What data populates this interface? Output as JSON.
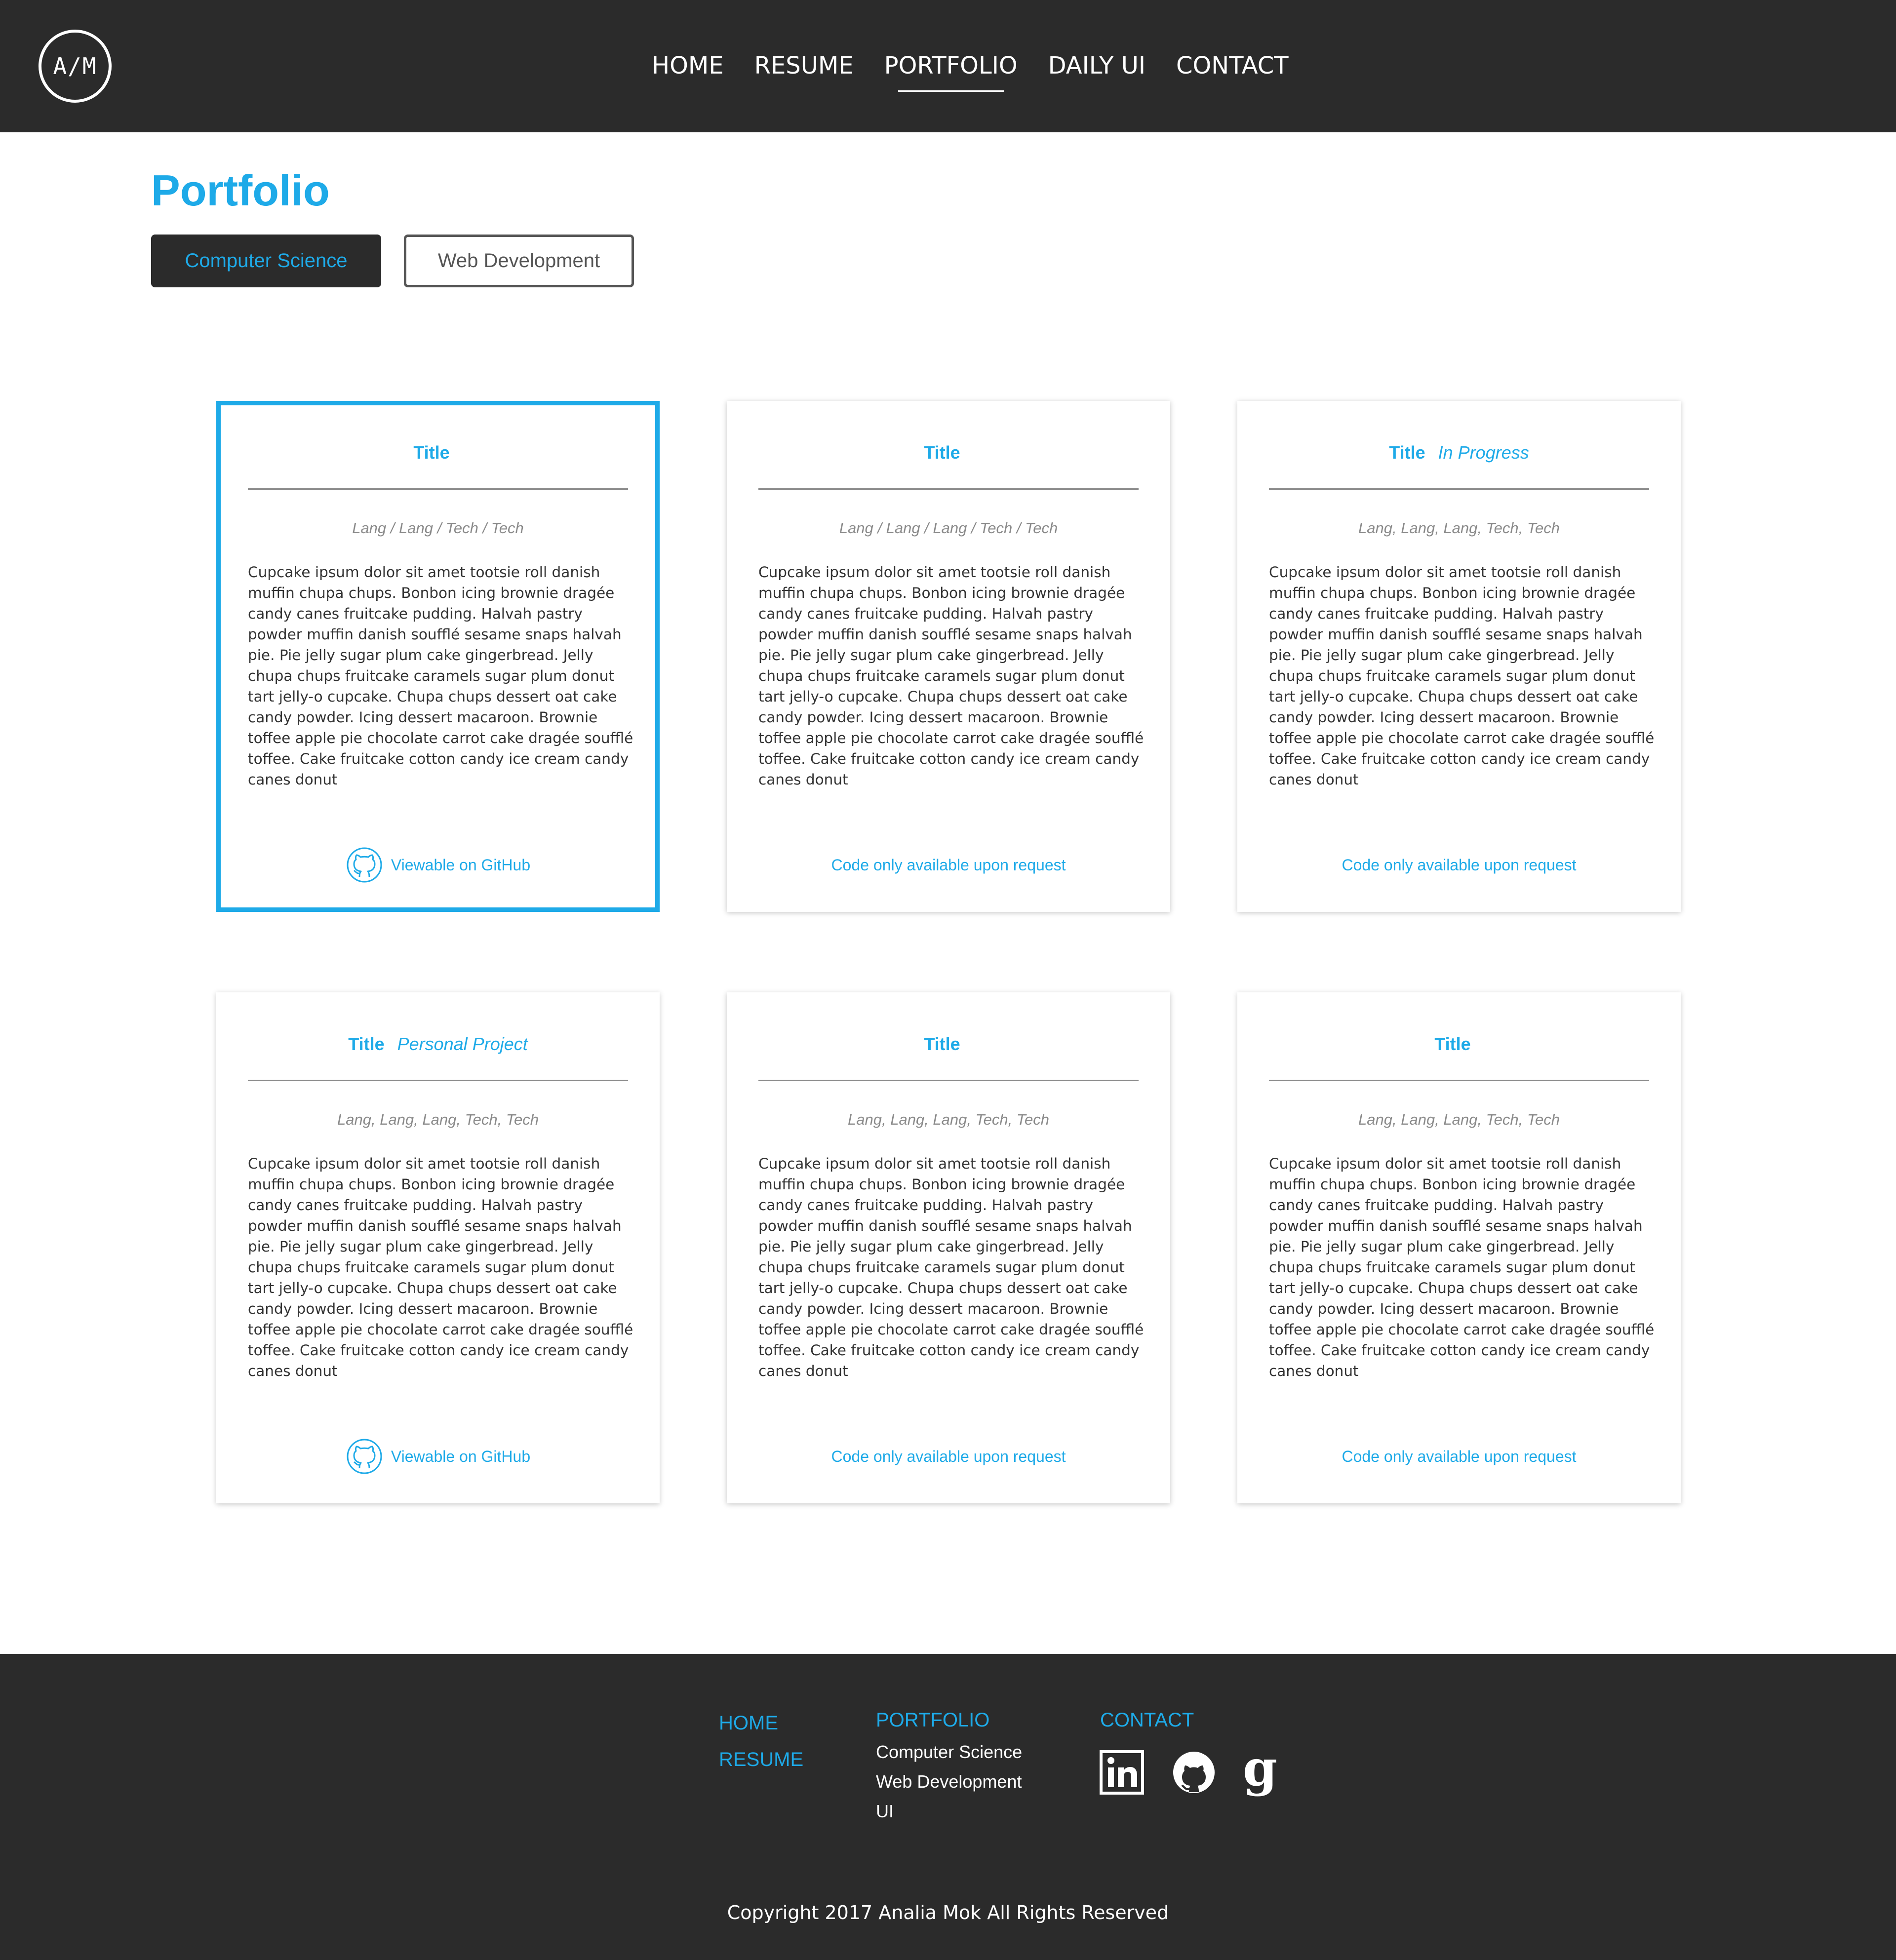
{
  "header": {
    "logo_text": "A/M",
    "nav": [
      {
        "label": "HOME",
        "active": false
      },
      {
        "label": "RESUME",
        "active": false
      },
      {
        "label": "PORTFOLIO",
        "active": true
      },
      {
        "label": "DAILY UI",
        "active": false
      },
      {
        "label": "CONTACT",
        "active": false
      }
    ]
  },
  "page": {
    "title": "Portfolio",
    "filters": [
      {
        "label": "Computer Science",
        "selected": true
      },
      {
        "label": "Web Development",
        "selected": false
      }
    ]
  },
  "cards": [
    {
      "title": "Title",
      "tag": "",
      "tech": "Lang / Lang / Tech / Tech",
      "body": "Cupcake ipsum dolor sit amet tootsie roll danish muffin chupa chups. Bonbon icing brownie dragée candy canes fruitcake pudding. Halvah pastry powder muffin danish soufflé sesame snaps halvah pie. Pie jelly sugar plum cake gingerbread. Jelly chupa chups fruitcake caramels sugar plum donut tart jelly-o cupcake. Chupa chups dessert oat cake candy powder. Icing dessert macaroon. Brownie toffee apple pie chocolate carrot cake dragée soufflé toffee. Cake fruitcake cotton candy ice cream candy canes donut",
      "footer": "Viewable on GitHub",
      "footer_icon": "github-icon",
      "selected": true
    },
    {
      "title": "Title",
      "tag": "",
      "tech": "Lang / Lang / Lang / Tech / Tech",
      "body": "Cupcake ipsum dolor sit amet tootsie roll danish muffin chupa chups. Bonbon icing brownie dragée candy canes fruitcake pudding. Halvah pastry powder muffin danish soufflé sesame snaps halvah pie. Pie jelly sugar plum cake gingerbread. Jelly chupa chups fruitcake caramels sugar plum donut tart jelly-o cupcake. Chupa chups dessert oat cake candy powder. Icing dessert macaroon. Brownie toffee apple pie chocolate carrot cake dragée soufflé toffee. Cake fruitcake cotton candy ice cream candy canes donut",
      "footer": "Code only available upon request",
      "footer_icon": "",
      "selected": false
    },
    {
      "title": "Title",
      "tag": "In Progress",
      "tech": "Lang, Lang, Lang, Tech, Tech",
      "body": "Cupcake ipsum dolor sit amet tootsie roll danish muffin chupa chups. Bonbon icing brownie dragée candy canes fruitcake pudding. Halvah pastry powder muffin danish soufflé sesame snaps halvah pie. Pie jelly sugar plum cake gingerbread. Jelly chupa chups fruitcake caramels sugar plum donut tart jelly-o cupcake. Chupa chups dessert oat cake candy powder. Icing dessert macaroon. Brownie toffee apple pie chocolate carrot cake dragée soufflé toffee. Cake fruitcake cotton candy ice cream candy canes donut",
      "footer": "Code only available upon request",
      "footer_icon": "",
      "selected": false
    },
    {
      "title": "Title",
      "tag": "Personal Project",
      "tech": "Lang, Lang, Lang, Tech, Tech",
      "body": "Cupcake ipsum dolor sit amet tootsie roll danish muffin chupa chups. Bonbon icing brownie dragée candy canes fruitcake pudding. Halvah pastry powder muffin danish soufflé sesame snaps halvah pie. Pie jelly sugar plum cake gingerbread. Jelly chupa chups fruitcake caramels sugar plum donut tart jelly-o cupcake. Chupa chups dessert oat cake candy powder. Icing dessert macaroon. Brownie toffee apple pie chocolate carrot cake dragée soufflé toffee. Cake fruitcake cotton candy ice cream candy canes donut",
      "footer": "Viewable on GitHub",
      "footer_icon": "github-icon",
      "selected": false
    },
    {
      "title": "Title",
      "tag": "",
      "tech": "Lang, Lang, Lang, Tech, Tech",
      "body": "Cupcake ipsum dolor sit amet tootsie roll danish muffin chupa chups. Bonbon icing brownie dragée candy canes fruitcake pudding. Halvah pastry powder muffin danish soufflé sesame snaps halvah pie. Pie jelly sugar plum cake gingerbread. Jelly chupa chups fruitcake caramels sugar plum donut tart jelly-o cupcake. Chupa chups dessert oat cake candy powder. Icing dessert macaroon. Brownie toffee apple pie chocolate carrot cake dragée soufflé toffee. Cake fruitcake cotton candy ice cream candy canes donut",
      "footer": "Code only available upon request",
      "footer_icon": "",
      "selected": false
    },
    {
      "title": "Title",
      "tag": "",
      "tech": "Lang, Lang, Lang, Tech, Tech",
      "body": "Cupcake ipsum dolor sit amet tootsie roll danish muffin chupa chups. Bonbon icing brownie dragée candy canes fruitcake pudding. Halvah pastry powder muffin danish soufflé sesame snaps halvah pie. Pie jelly sugar plum cake gingerbread. Jelly chupa chups fruitcake caramels sugar plum donut tart jelly-o cupcake. Chupa chups dessert oat cake candy powder. Icing dessert macaroon. Brownie toffee apple pie chocolate carrot cake dragée soufflé toffee. Cake fruitcake cotton candy ice cream candy canes donut",
      "footer": "Code only available upon request",
      "footer_icon": "",
      "selected": false
    }
  ],
  "footer": {
    "col1": [
      "HOME",
      "RESUME"
    ],
    "portfolio_label": "PORTFOLIO",
    "portfolio_sub": [
      "Computer Science",
      "Web Development",
      "UI"
    ],
    "contact_label": "CONTACT",
    "social_icons": [
      "linkedin-icon",
      "github-icon",
      "google-icon"
    ],
    "copyright": "Copyright 2017 Analia Mok All Rights Reserved"
  },
  "colors": {
    "accent": "#1eaae8",
    "dark": "#2b2b2b",
    "text": "#333333",
    "muted": "#8a8a8a"
  }
}
